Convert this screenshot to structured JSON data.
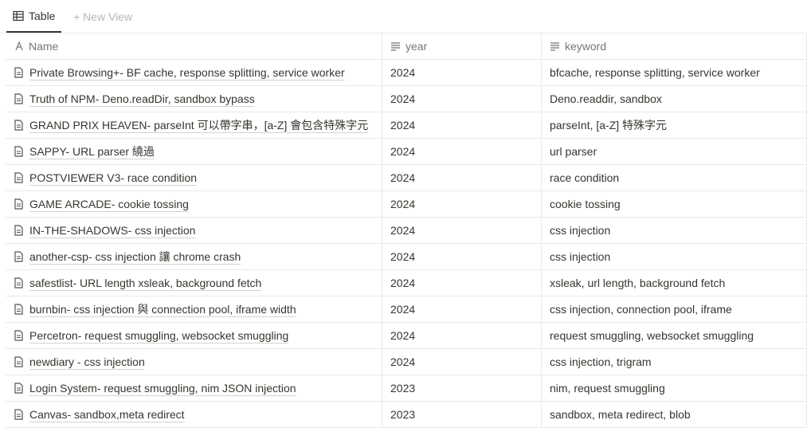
{
  "viewbar": {
    "active_tab": "Table",
    "new_view": "+ New View"
  },
  "table": {
    "columns": {
      "name": "Name",
      "year": "year",
      "keyword": "keyword"
    },
    "rows": [
      {
        "name": "Private Browsing+- BF cache, response splitting, service worker",
        "year": "2024",
        "keyword": "bfcache, response splitting, service worker"
      },
      {
        "name": "Truth of NPM- Deno.readDir, sandbox bypass",
        "year": "2024",
        "keyword": "Deno.readdir, sandbox"
      },
      {
        "name": "GRAND PRIX HEAVEN- parseInt 可以帶字串，[a-Z] 會包含特殊字元",
        "year": "2024",
        "keyword": "parseInt, [a-Z] 特殊字元"
      },
      {
        "name": "SAPPY- URL parser 繞過",
        "year": "2024",
        "keyword": "url parser"
      },
      {
        "name": "POSTVIEWER V3- race condition",
        "year": "2024",
        "keyword": "race condition"
      },
      {
        "name": "GAME ARCADE- cookie tossing",
        "year": "2024",
        "keyword": "cookie tossing"
      },
      {
        "name": "IN-THE-SHADOWS- css injection",
        "year": "2024",
        "keyword": "css injection"
      },
      {
        "name": "another-csp- css injection 讓 chrome crash",
        "year": "2024",
        "keyword": "css injection"
      },
      {
        "name": "safestlist- URL length xsleak, background fetch",
        "year": "2024",
        "keyword": "xsleak, url length, background fetch"
      },
      {
        "name": "burnbin- css injection 與 connection pool, iframe width",
        "year": "2024",
        "keyword": "css injection, connection pool, iframe"
      },
      {
        "name": "Percetron- request smuggling, websocket smuggling",
        "year": "2024",
        "keyword": "request smuggling, websocket smuggling"
      },
      {
        "name": "newdiary - css injection",
        "year": "2024",
        "keyword": "css injection, trigram"
      },
      {
        "name": "Login System- request smuggling, nim JSON injection",
        "year": "2023",
        "keyword": "nim, request smuggling"
      },
      {
        "name": "Canvas- sandbox,meta redirect",
        "year": "2023",
        "keyword": "sandbox, meta redirect, blob"
      }
    ]
  }
}
